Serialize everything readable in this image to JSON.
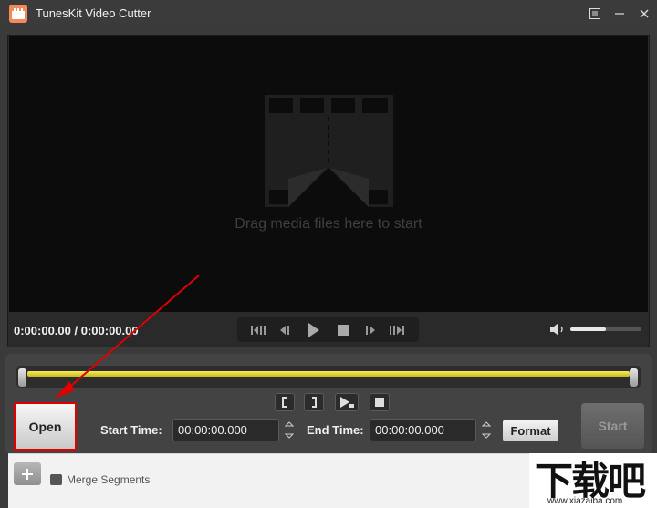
{
  "window": {
    "title": "TunesKit Video Cutter",
    "icon": "tuneskit-logo-icon",
    "buttons": [
      "menu-icon",
      "minimize-icon",
      "close-icon"
    ]
  },
  "player": {
    "drop_hint": "Drag media files here to start",
    "timecode": "0:00:00.00 / 0:00:00.00",
    "transport": [
      "prev-clip-icon",
      "step-back-icon",
      "play-icon",
      "stop-icon",
      "step-forward-icon",
      "next-clip-icon"
    ],
    "volume_level": 0.5
  },
  "editor": {
    "segment_tools": [
      "mark-start-icon",
      "mark-end-icon",
      "play-segment-icon",
      "stop-icon"
    ],
    "open_label": "Open",
    "start_time_label": "Start Time:",
    "start_time_value": "00:00:00.000",
    "end_time_label": "End Time:",
    "end_time_value": "00:00:00.000",
    "format_label": "Format",
    "start_label": "Start"
  },
  "segments": {
    "add_icon": "plus-icon",
    "merge_label": "Merge Segments"
  },
  "watermark": {
    "text": "下载吧",
    "url": "www.xiazaiba.com"
  },
  "colors": {
    "timeline": "#e8dc3a",
    "highlight": "#e00000",
    "accent": "#f28a5a"
  }
}
